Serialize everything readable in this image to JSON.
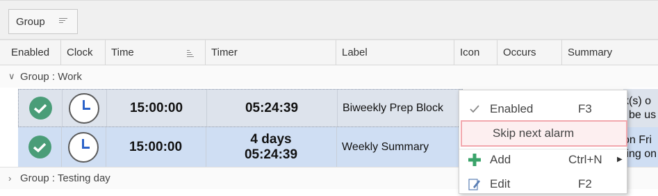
{
  "group_panel": {
    "label": "Group",
    "sort_icon": "sort-lines-icon"
  },
  "columns": [
    "Enabled",
    "Clock",
    "Time",
    "Timer",
    "Label",
    "Icon",
    "Occurs",
    "Summary"
  ],
  "groups": [
    {
      "label": "Group : Work",
      "expanded": true,
      "chevron": "chevron-down-icon"
    },
    {
      "label": "Group : Testing day",
      "expanded": false,
      "chevron": "chevron-right-icon"
    }
  ],
  "rows": [
    {
      "time": "15:00:00",
      "timer": "05:24:39",
      "label": "Biweekly Prep Block",
      "summary_line1": "k(s) o",
      "summary_line2": "l be us"
    },
    {
      "time": "15:00:00",
      "timer_line1": "4 days",
      "timer_line2": "05:24:39",
      "label": "Weekly Summary",
      "summary_line1": "on Fri",
      "summary_line2": "ting on"
    }
  ],
  "context_menu": {
    "items": [
      {
        "label": "Enabled",
        "shortcut": "F3",
        "icon": "checkmark-icon"
      },
      {
        "label": "Skip next alarm",
        "shortcut": "",
        "icon": ""
      },
      {
        "label": "Add",
        "shortcut": "Ctrl+N",
        "icon": "plus-icon"
      },
      {
        "label": "Edit",
        "shortcut": "F2",
        "icon": "pencil-icon"
      }
    ]
  },
  "colors": {
    "enabled_check": "#4a9d78",
    "selected_row": "#cfdef3",
    "focused_row": "#dde3ec",
    "menu_highlight_border": "#f2a7ad",
    "add_icon": "#3aa36a"
  }
}
